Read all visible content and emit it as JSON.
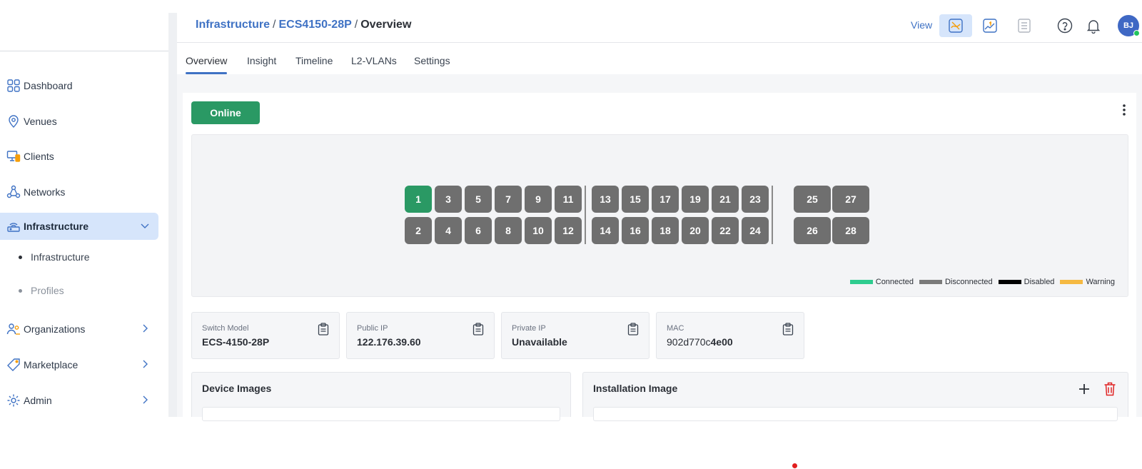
{
  "sidebar": {
    "items": [
      {
        "label": "Dashboard",
        "icon": "dashboard-grid-icon"
      },
      {
        "label": "Venues",
        "icon": "location-pin-icon"
      },
      {
        "label": "Clients",
        "icon": "clients-monitor-icon"
      },
      {
        "label": "Networks",
        "icon": "network-nodes-icon"
      },
      {
        "label": "Infrastructure",
        "icon": "router-icon",
        "active": true
      },
      {
        "label": "Organizations",
        "icon": "organizations-icon"
      },
      {
        "label": "Marketplace",
        "icon": "tag-icon"
      },
      {
        "label": "Admin",
        "icon": "admin-gear-icon"
      }
    ],
    "subitems": [
      {
        "label": "Infrastructure"
      },
      {
        "label": "Profiles"
      }
    ]
  },
  "header": {
    "breadcrumb": {
      "root": "Infrastructure",
      "device": "ECS4150-28P",
      "current": "Overview",
      "separator": "/"
    },
    "view_label": "View",
    "avatar_initials": "BJ"
  },
  "tabs": [
    "Overview",
    "Insight",
    "Timeline",
    "L2-VLANs",
    "Settings"
  ],
  "status_label": "Online",
  "ports": {
    "top_row": [
      "1",
      "3",
      "5",
      "7",
      "9",
      "11",
      "13",
      "15",
      "17",
      "19",
      "21",
      "23",
      "25",
      "27"
    ],
    "bottom_row": [
      "2",
      "4",
      "6",
      "8",
      "10",
      "12",
      "14",
      "16",
      "18",
      "20",
      "22",
      "24",
      "26",
      "28"
    ],
    "connected": [
      "1"
    ]
  },
  "legend": [
    {
      "label": "Connected",
      "color": "#2ecc8f"
    },
    {
      "label": "Disconnected",
      "color": "#7a7a7a"
    },
    {
      "label": "Disabled",
      "color": "#000000"
    },
    {
      "label": "Warning",
      "color": "#f5b942"
    }
  ],
  "info": {
    "switch_model": {
      "label": "Switch Model",
      "value": "ECS-4150-28P"
    },
    "public_ip": {
      "label": "Public IP",
      "value": "122.176.39.60"
    },
    "private_ip": {
      "label": "Private IP",
      "value": "Unavailable"
    },
    "mac": {
      "label": "MAC",
      "value_prefix": "902d770c",
      "value_suffix": "4e00"
    }
  },
  "sections": {
    "device_images": "Device Images",
    "installation_image": "Installation Image"
  },
  "colors": {
    "accent": "#3f72c4",
    "online": "#2a9964",
    "port_default": "#6f6f6f",
    "delete": "#e02424"
  }
}
